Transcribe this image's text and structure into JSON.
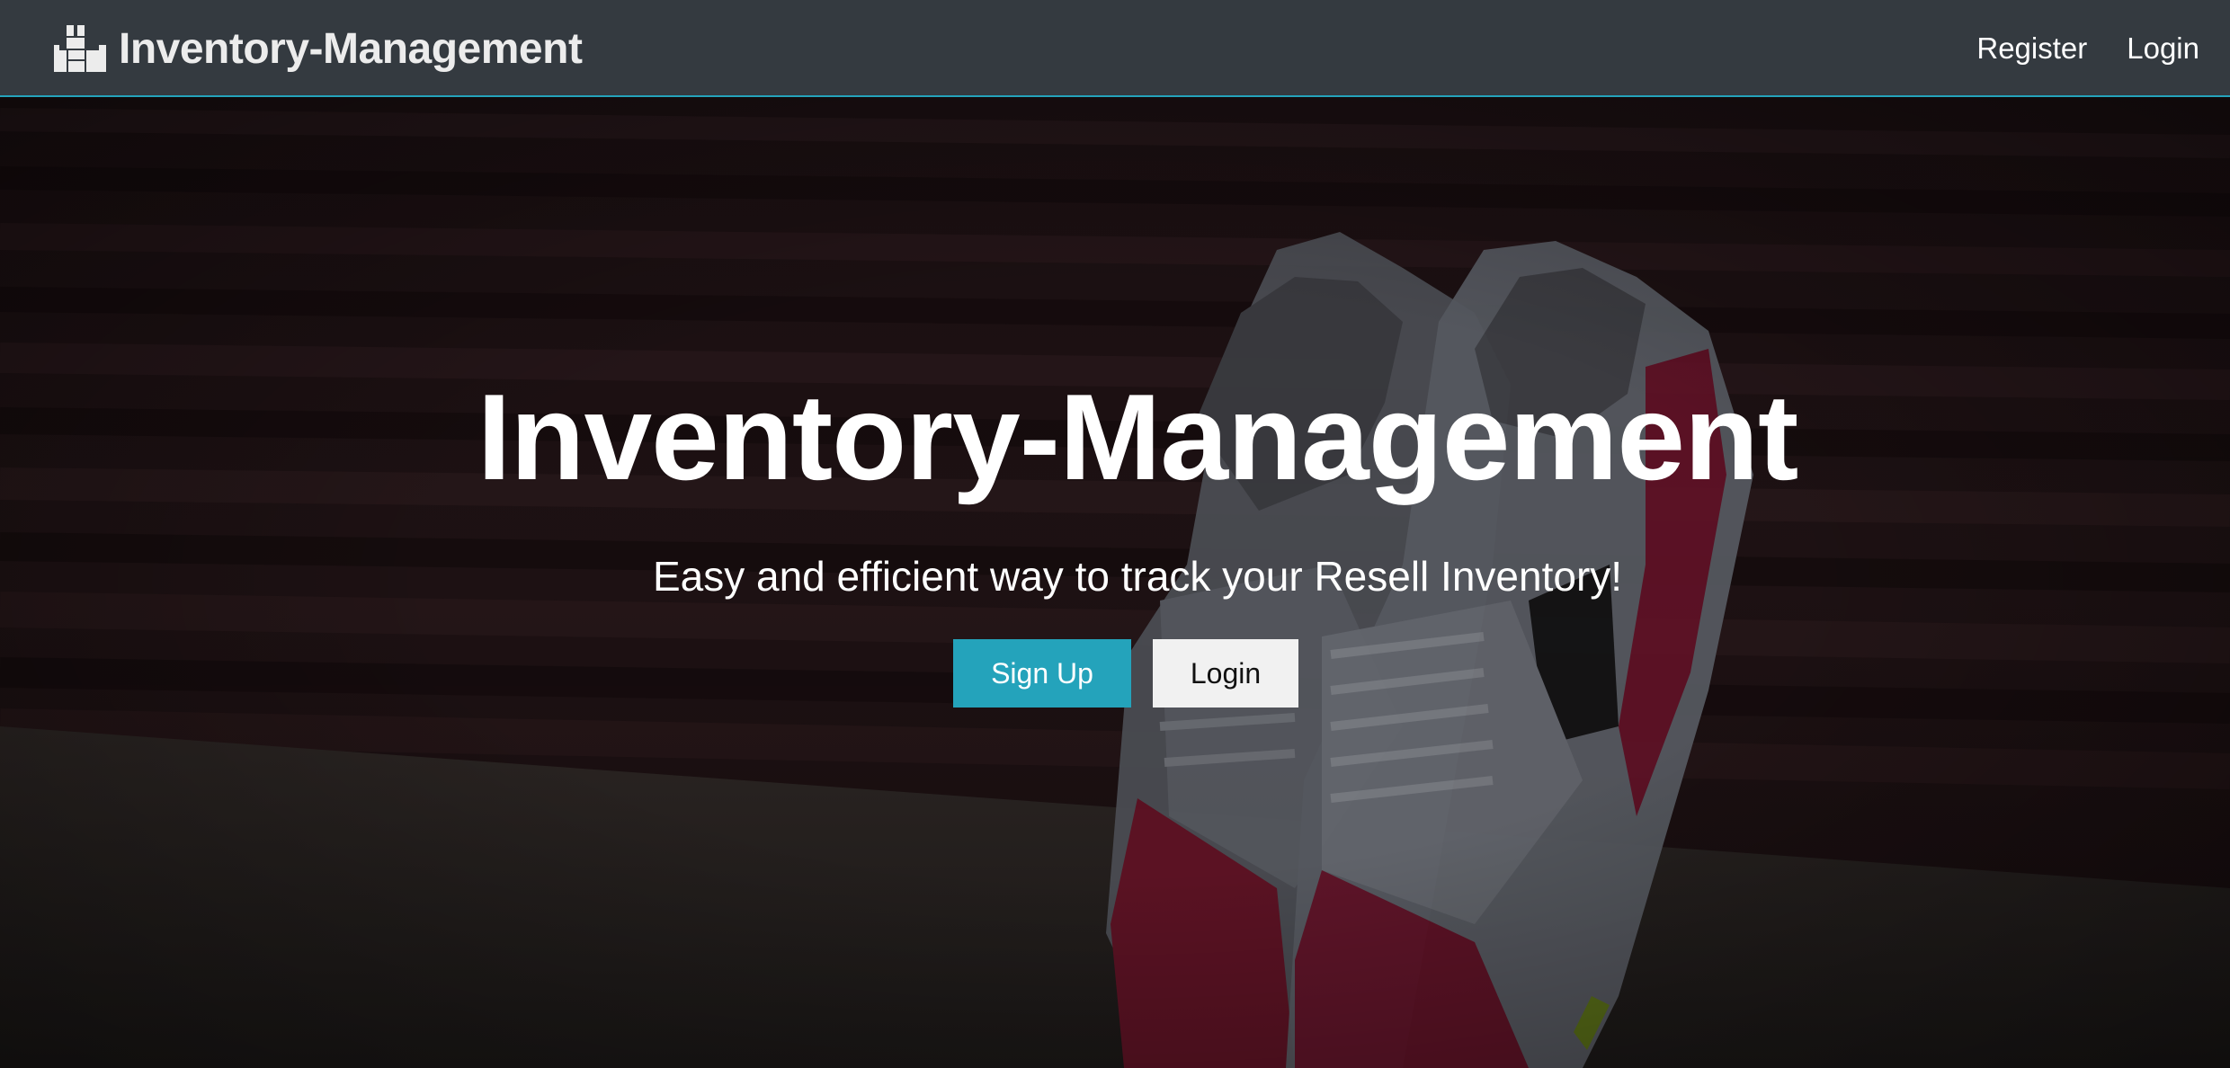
{
  "navbar": {
    "brand_text": "Inventory-Management",
    "brand_icon": "boxes-icon",
    "links": [
      "Register",
      "Login"
    ]
  },
  "hero": {
    "title": "Inventory-Management",
    "subtitle": "Easy and efficient way to track your Resell Inventory!",
    "buttons": {
      "signup": "Sign Up",
      "login": "Login"
    },
    "background": "sneakers-photo"
  },
  "colors": {
    "navbar_bg": "#343a40",
    "accent": "#24a3bb",
    "light_button": "#f1f1f1",
    "text_light": "#ffffff"
  }
}
